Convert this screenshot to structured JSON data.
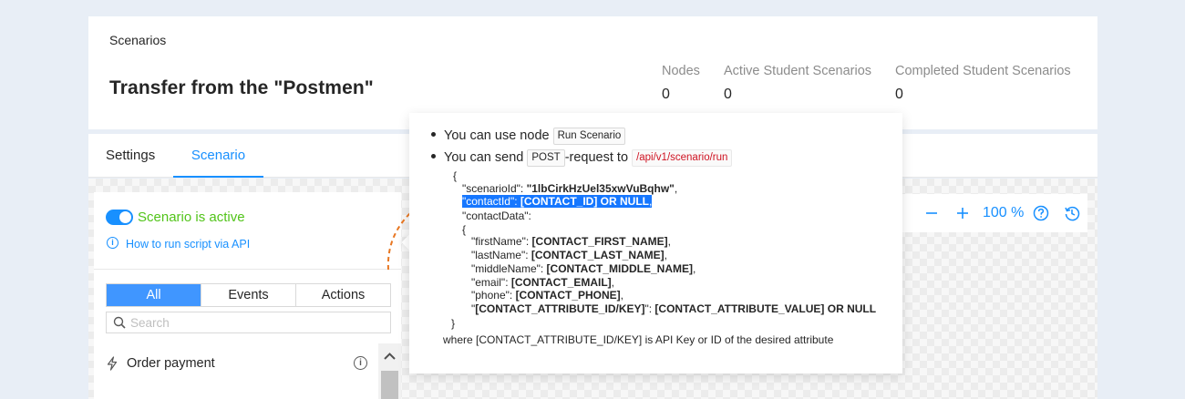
{
  "header": {
    "breadcrumb": "Scenarios",
    "title": "Transfer from the \"Postmen\"",
    "stats": [
      {
        "label": "Nodes",
        "value": "0"
      },
      {
        "label": "Active Student Scenarios",
        "value": "0"
      },
      {
        "label": "Completed Student Scenarios",
        "value": "0"
      }
    ]
  },
  "tabs": [
    {
      "label": "Settings",
      "active": false
    },
    {
      "label": "Scenario",
      "active": true
    }
  ],
  "side_panel": {
    "status_label": "Scenario is active",
    "howto_link": "How to run script via API",
    "filter_tabs": [
      "All",
      "Events",
      "Actions"
    ],
    "search_placeholder": "Search",
    "items": [
      {
        "label": "Order payment",
        "icon": "bolt-icon"
      }
    ]
  },
  "toolbar": {
    "zoom": "100 %"
  },
  "popover": {
    "line1_text": "You can use node",
    "line1_tag": "Run Scenario",
    "line2_text_a": "You can send",
    "line2_tag_method": "POST",
    "line2_text_b": "-request to",
    "line2_tag_url": "/api/v1/scenario/run",
    "json": {
      "open": "{",
      "scenario_key": "\"scenarioId\": ",
      "scenario_val": "\"1lbCirkHzUel35xwVuBqhw\"",
      "scenario_comma": ",",
      "contact_key": "\"contactId\": ",
      "contact_val": "[CONTACT_ID] OR NULL",
      "contact_comma": ",",
      "contactdata_key": "\"contactData\":",
      "inner_open": "{",
      "fields": [
        {
          "key": "\"firstName\": ",
          "val": "[CONTACT_FIRST_NAME]",
          "end": ","
        },
        {
          "key": "\"lastName\": ",
          "val": "[CONTACT_LAST_NAME]",
          "end": ","
        },
        {
          "key": "\"middleName\": ",
          "val": "[CONTACT_MIDDLE_NAME]",
          "end": ","
        },
        {
          "key": "\"email\": ",
          "val": "[CONTACT_EMAIL]",
          "end": ","
        },
        {
          "key": "\"phone\": ",
          "val": "[CONTACT_PHONE]",
          "end": ","
        }
      ],
      "attr_q1": "\"",
      "attr_key": "[CONTACT_ATTRIBUTE_ID/KEY]",
      "attr_q2": "\": ",
      "attr_val": "[CONTACT_ATTRIBUTE_VALUE] OR NULL",
      "inner_close": "}"
    },
    "note": "where [CONTACT_ATTRIBUTE_ID/KEY] is API Key or ID of the desired attribute"
  },
  "colors": {
    "accent": "#1890ff",
    "active_green": "#52c41a",
    "connector_orange": "#e87722",
    "highlight": "#1677ff"
  }
}
